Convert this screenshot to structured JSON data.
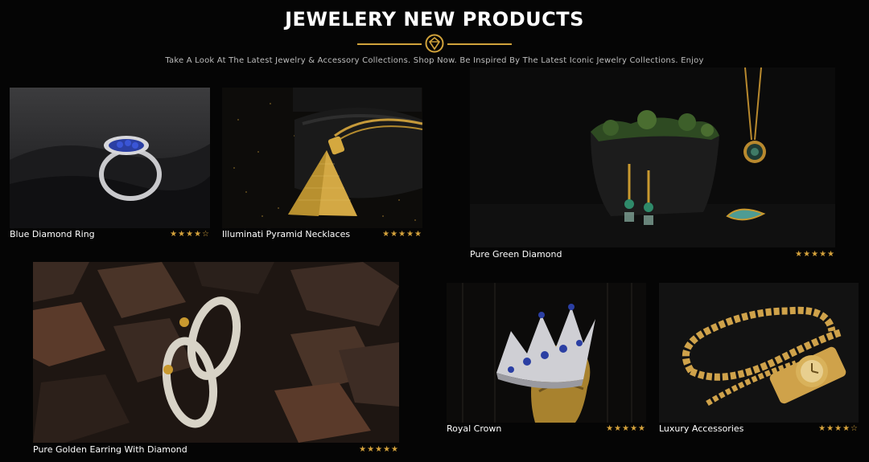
{
  "header": {
    "title": "JEWELERY NEW PRODUCTS",
    "subtitle": "Take A Look At The Latest Jewelry & Accessory Collections. Shop Now. Be Inspired By The Latest Iconic Jewelry Collections. Enjoy"
  },
  "colors": {
    "accent": "#d1a33b",
    "background": "#050505",
    "text": "#ffffff"
  },
  "products": [
    {
      "name": "Blue Diamond Ring",
      "rating": 4,
      "stars": "★★★★☆"
    },
    {
      "name": "Illuminati Pyramid Necklaces",
      "rating": 4.5,
      "stars": "★★★★★"
    },
    {
      "name": "Pure Green Diamond",
      "rating": 5,
      "stars": "★★★★★"
    },
    {
      "name": "Pure Golden Earring With Diamond",
      "rating": 5,
      "stars": "★★★★★"
    },
    {
      "name": "Royal Crown",
      "rating": 4.5,
      "stars": "★★★★★"
    },
    {
      "name": "Luxury Accessories",
      "rating": 3.5,
      "stars": "★★★★☆"
    }
  ]
}
